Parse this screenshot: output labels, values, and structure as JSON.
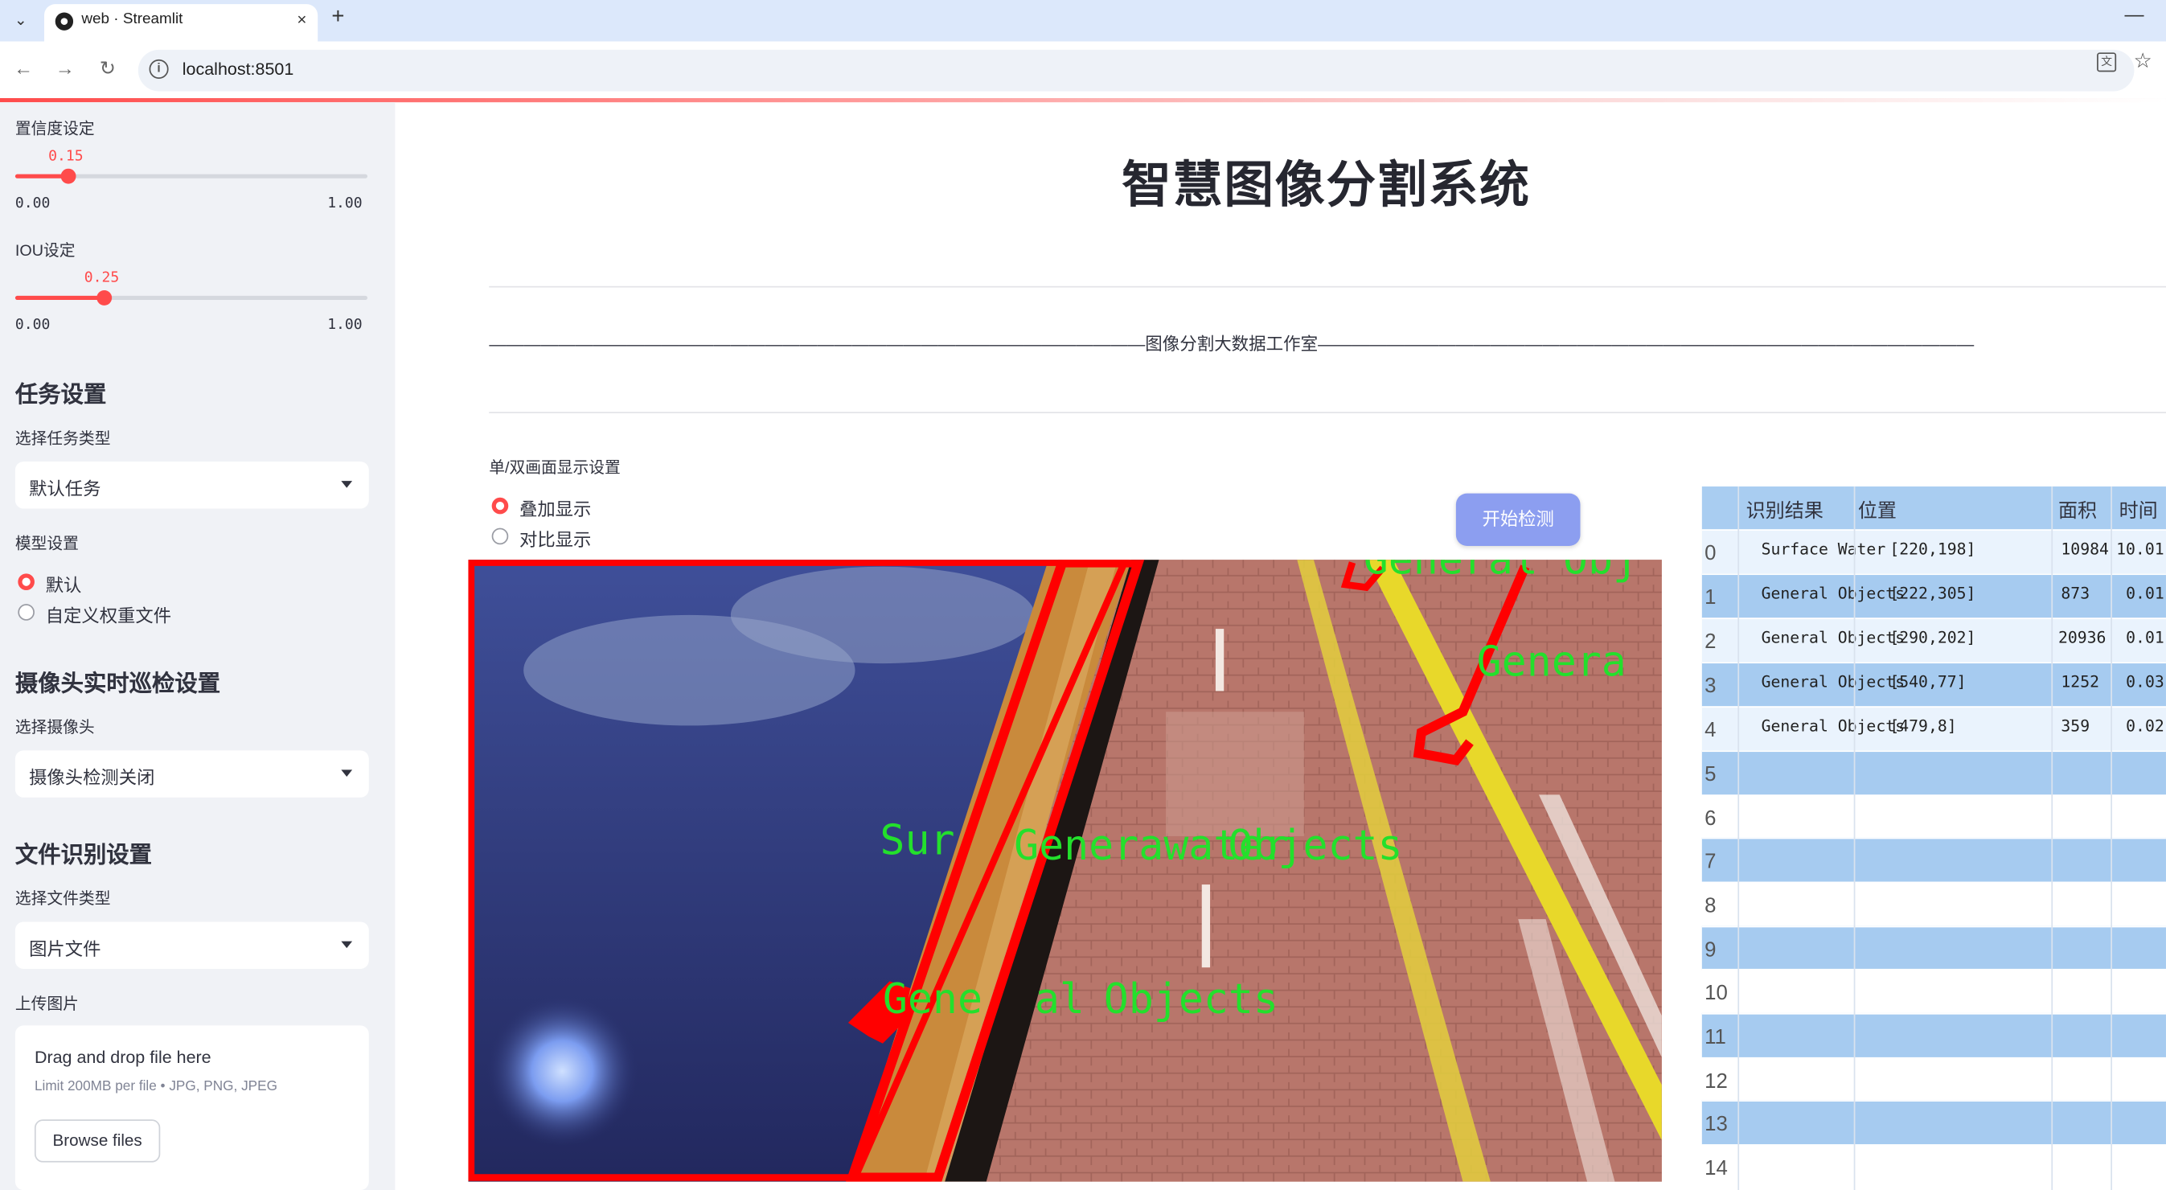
{
  "browser": {
    "tab_title": "web · Streamlit",
    "url": "localhost:8501",
    "new_tab": "+",
    "close": "×",
    "minimize": "—",
    "back": "←",
    "forward": "→",
    "reload": "↻",
    "tab_dropdown": "⌄",
    "info": "i",
    "translate": "文",
    "star": "☆"
  },
  "sidebar": {
    "confidence_label": "置信度设定",
    "confidence": {
      "value": 0.15,
      "value_text": "0.15",
      "min": "0.00",
      "max": "1.00"
    },
    "iou_label": "IOU设定",
    "iou": {
      "value": 0.25,
      "value_text": "0.25",
      "min": "0.00",
      "max": "1.00"
    },
    "task_heading": "任务设置",
    "task_type_label": "选择任务类型",
    "task_type_value": "默认任务",
    "model_label": "模型设置",
    "model_options": [
      "默认",
      "自定义权重文件"
    ],
    "model_selected": "默认",
    "camera_heading": "摄像头实时巡检设置",
    "camera_label": "选择摄像头",
    "camera_value": "摄像头检测关闭",
    "file_heading": "文件识别设置",
    "file_type_label": "选择文件类型",
    "file_type_value": "图片文件",
    "upload_label": "上传图片",
    "upload_title": "Drag and drop file here",
    "upload_hint": "Limit 200MB per file • JPG, PNG, JPEG",
    "browse_label": "Browse files"
  },
  "main": {
    "title": "智慧图像分割系统",
    "studio_line": "——————————————————————————————————————图像分割大数据工作室——————————————————————————————————————",
    "display_label": "单/双画面显示设置",
    "display_options": [
      "叠加显示",
      "对比显示"
    ],
    "display_selected": "叠加显示",
    "detect_button": "开始检测"
  },
  "image_overlay_labels": [
    "General Obj",
    "Genera",
    "Sur",
    "Generawater",
    "Objects",
    "Gene",
    "al",
    "Objects"
  ],
  "results_table": {
    "headers": [
      "识别结果",
      "位置",
      "面积",
      "时间"
    ],
    "rows": [
      {
        "index": "0",
        "result": "Surface Water",
        "position": "[220,198]",
        "area": "10984",
        "time": "10.01"
      },
      {
        "index": "1",
        "result": "General Objects",
        "position": "[222,305]",
        "area": "873",
        "time": "0.01"
      },
      {
        "index": "2",
        "result": "General Objects",
        "position": "[290,202]",
        "area": "20936",
        "time": "0.01"
      },
      {
        "index": "3",
        "result": "General Objects",
        "position": "[540,77]",
        "area": "1252",
        "time": "0.03"
      },
      {
        "index": "4",
        "result": "General Objects",
        "position": "[479,8]",
        "area": "359",
        "time": "0.02"
      }
    ],
    "empty_indices": [
      "5",
      "6",
      "7",
      "8",
      "9",
      "10",
      "11",
      "12",
      "13",
      "14"
    ]
  }
}
